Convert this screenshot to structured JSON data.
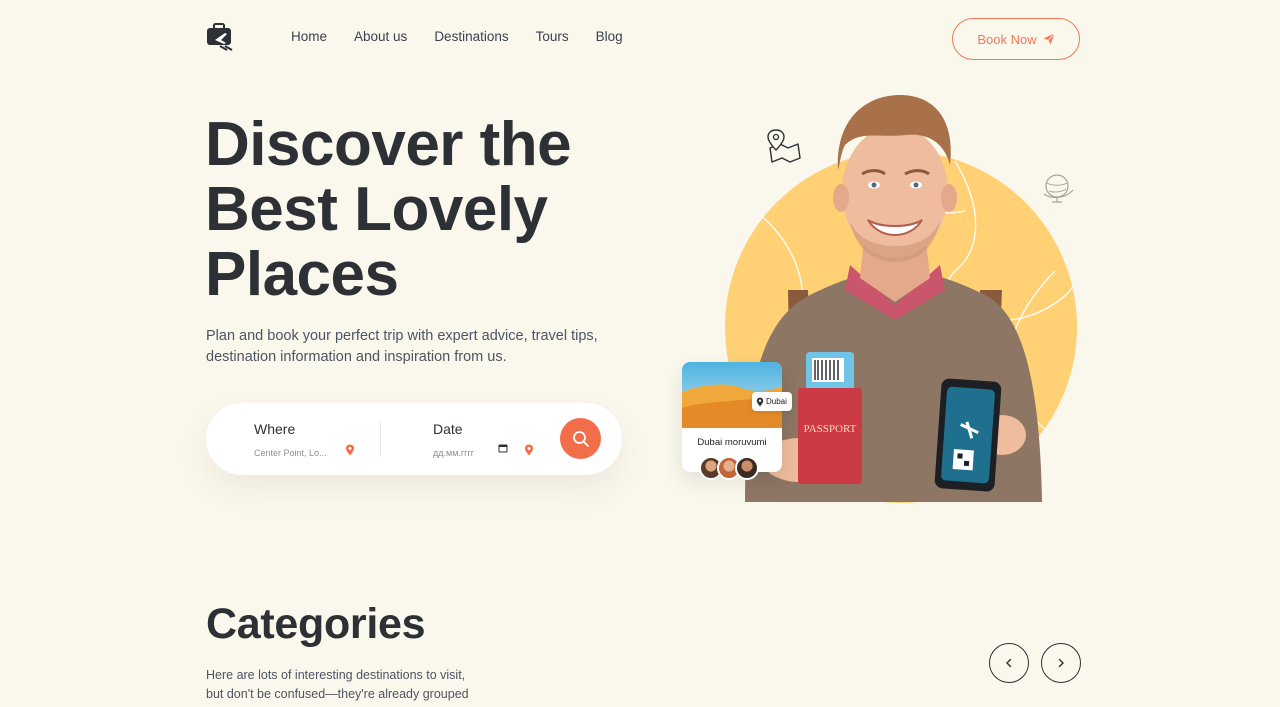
{
  "nav": {
    "items": [
      {
        "label": "Home"
      },
      {
        "label": "About us"
      },
      {
        "label": "Destinations"
      },
      {
        "label": "Tours"
      },
      {
        "label": "Blog"
      }
    ],
    "book_label": "Book Now"
  },
  "hero": {
    "title_lines": [
      "Discover the",
      "Best Lovely",
      "Places"
    ],
    "subtitle_1": "Plan and book your perfect trip with expert advice, travel tips,",
    "subtitle_2": "destination information and inspiration from us."
  },
  "search": {
    "where_label": "Where",
    "where_value": "Center Point, Lo...",
    "date_label": "Date",
    "date_value": "дд.мм.гггг"
  },
  "card": {
    "tag": "Dubai",
    "title": "Dubai moruvumi"
  },
  "passport_text": "PASSPORT",
  "categories": {
    "title": "Categories",
    "desc_1": "Here are lots of interesting destinations to visit,",
    "desc_2": "but don't be confused—they're already grouped"
  },
  "colors": {
    "background": "#faf7ed",
    "accent": "#f26d4a",
    "sun": "#ffd074"
  }
}
